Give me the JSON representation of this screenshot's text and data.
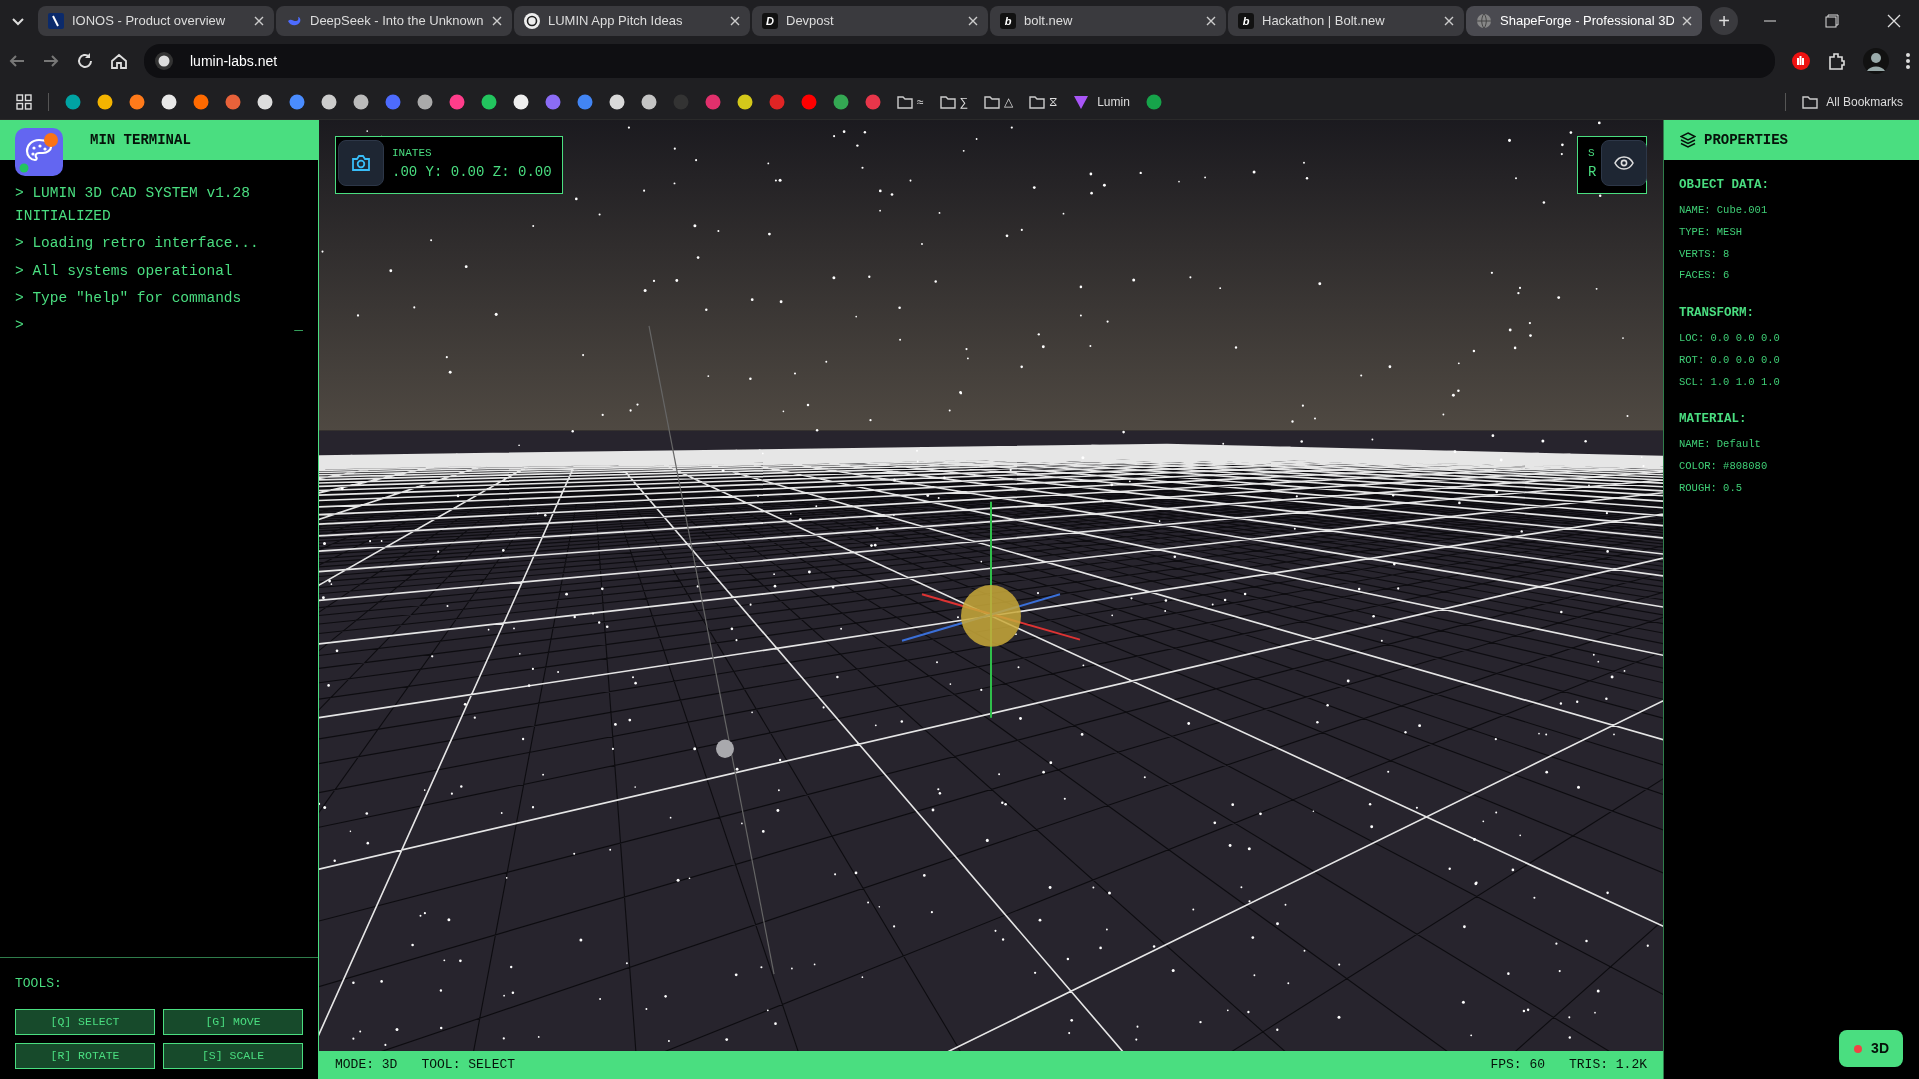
{
  "browser": {
    "tabs": [
      {
        "title": "IONOS - Product overview",
        "selected": false,
        "favicon": {
          "kind": "slash"
        }
      },
      {
        "title": "DeepSeek - Into the Unknown",
        "selected": false,
        "favicon": {
          "kind": "whale"
        }
      },
      {
        "title": "LUMIN App Pitch Ideas",
        "selected": false,
        "favicon": {
          "kind": "knot"
        }
      },
      {
        "title": "Devpost",
        "selected": false,
        "favicon": {
          "kind": "letter",
          "text": "D"
        }
      },
      {
        "title": "bolt.new",
        "selected": false,
        "favicon": {
          "kind": "letter",
          "text": "b"
        }
      },
      {
        "title": "Hackathon | Bolt.new",
        "selected": false,
        "favicon": {
          "kind": "letter",
          "text": "b"
        }
      },
      {
        "title": "ShapeForge - Professional 3D",
        "selected": true,
        "favicon": {
          "kind": "globe"
        }
      }
    ],
    "new_tab": "+",
    "address": "lumin-labs.net",
    "bookmarks": [
      {
        "kind": "favicon",
        "color": "#00a3a3"
      },
      {
        "kind": "favicon",
        "color": "#f4b400"
      },
      {
        "kind": "favicon",
        "color": "#ff7a1a"
      },
      {
        "kind": "favicon",
        "color": "#e8e8e8"
      },
      {
        "kind": "favicon",
        "color": "#ff6a00"
      },
      {
        "kind": "favicon",
        "color": "#e8623a"
      },
      {
        "kind": "favicon",
        "color": "#dddddd"
      },
      {
        "kind": "favicon",
        "color": "#4a8cff"
      },
      {
        "kind": "favicon",
        "color": "#cccccc"
      },
      {
        "kind": "favicon",
        "color": "#bbbbbb"
      },
      {
        "kind": "favicon",
        "color": "#4d6bfe"
      },
      {
        "kind": "favicon",
        "color": "#aaaaaa"
      },
      {
        "kind": "favicon",
        "color": "#ff3d8b"
      },
      {
        "kind": "favicon",
        "color": "#22c55e"
      },
      {
        "kind": "favicon",
        "color": "#eeeeee"
      },
      {
        "kind": "favicon",
        "color": "#8b6cf6"
      },
      {
        "kind": "favicon",
        "color": "#4285f4"
      },
      {
        "kind": "favicon",
        "color": "#d9d9d9"
      },
      {
        "kind": "favicon",
        "color": "#c4c4c4"
      },
      {
        "kind": "favicon",
        "color": "#333333"
      },
      {
        "kind": "favicon",
        "color": "#e1306c"
      },
      {
        "kind": "favicon",
        "color": "#d4c81a"
      },
      {
        "kind": "favicon",
        "color": "#e02424"
      },
      {
        "kind": "favicon",
        "color": "#ff0000"
      },
      {
        "kind": "favicon",
        "color": "#34a853"
      },
      {
        "kind": "favicon",
        "color": "#e8364a"
      },
      {
        "kind": "folder",
        "label": "≈"
      },
      {
        "kind": "folder",
        "label": "∑"
      },
      {
        "kind": "folder",
        "label": "△"
      },
      {
        "kind": "folder",
        "label": "⧖"
      },
      {
        "kind": "link",
        "label": "Lumin",
        "color": "#a855f7"
      },
      {
        "kind": "favicon",
        "color": "#16a34a"
      }
    ],
    "all_bookmarks": "All Bookmarks"
  },
  "terminal": {
    "title": "MIN TERMINAL",
    "lines": [
      "> LUMIN 3D CAD SYSTEM v1.28 INITIALIZED",
      "> Loading retro interface...",
      "> All systems operational",
      "> Type \"help\" for commands"
    ],
    "prompt": ">",
    "cursor": "_"
  },
  "tools": {
    "title": "TOOLS:",
    "buttons": [
      "[Q] SELECT",
      "[G] MOVE",
      "[R] ROTATE",
      "[S] SCALE"
    ]
  },
  "viewport": {
    "coordinates": {
      "label": "INATES",
      "value": ".00 Y: 0.00 Z: 0.00"
    },
    "status_box": {
      "line_1": "S",
      "line_2": "R"
    }
  },
  "status_bar": {
    "left": [
      "MODE: 3D",
      "TOOL: SELECT"
    ],
    "right": [
      "FPS: 60",
      "TRIS: 1.2K"
    ]
  },
  "properties": {
    "title": "PROPERTIES",
    "sections": [
      {
        "heading": "OBJECT DATA:",
        "rows": [
          "NAME: Cube.001",
          "TYPE: MESH",
          "VERTS: 8",
          "FACES: 6"
        ]
      },
      {
        "heading": "TRANSFORM:",
        "rows": [
          "LOC: 0.0 0.0 0.0",
          "ROT: 0.0 0.0 0.0",
          "SCL: 1.0 1.0 1.0"
        ]
      },
      {
        "heading": "MATERIAL:",
        "rows": [
          "NAME: Default",
          "COLOR: #808080",
          "ROUGH: 0.5"
        ]
      }
    ]
  },
  "mode_badge": "3D"
}
